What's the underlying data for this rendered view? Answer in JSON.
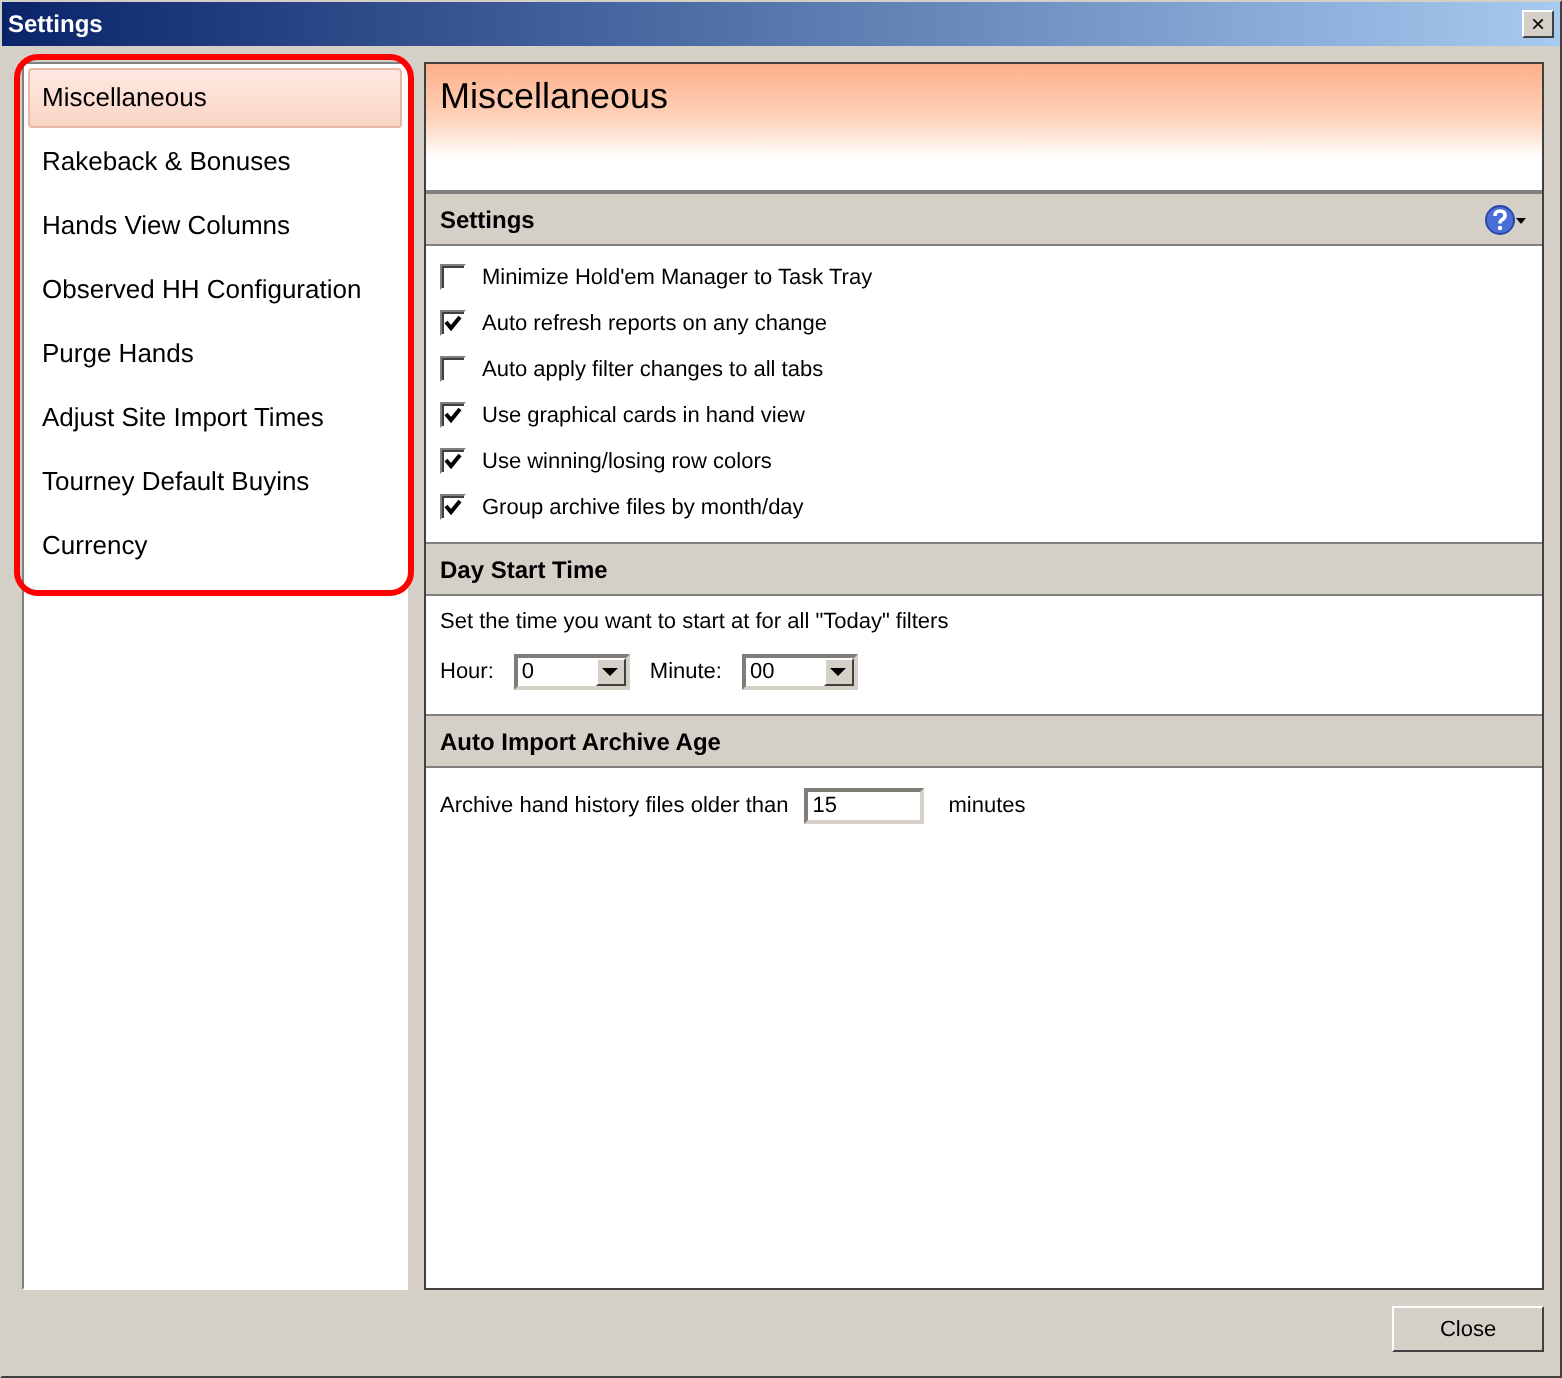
{
  "window": {
    "title": "Settings",
    "close": "×"
  },
  "sidebar": {
    "items": [
      {
        "label": "Miscellaneous",
        "selected": true
      },
      {
        "label": "Rakeback & Bonuses",
        "selected": false
      },
      {
        "label": "Hands View Columns",
        "selected": false
      },
      {
        "label": "Observed HH Configuration",
        "selected": false
      },
      {
        "label": "Purge Hands",
        "selected": false
      },
      {
        "label": "Adjust Site Import Times",
        "selected": false
      },
      {
        "label": "Tourney Default Buyins",
        "selected": false
      },
      {
        "label": "Currency",
        "selected": false
      }
    ]
  },
  "page_title": "Miscellaneous",
  "sections": [
    {
      "title": "Settings",
      "help": true,
      "kind": "checks",
      "options": [
        {
          "label": "Minimize Hold'em Manager to Task Tray",
          "checked": false
        },
        {
          "label": "Auto refresh reports on any change",
          "checked": true
        },
        {
          "label": "Auto apply filter changes to all tabs",
          "checked": false
        },
        {
          "label": "Use graphical cards in hand view",
          "checked": true
        },
        {
          "label": "Use winning/losing row colors",
          "checked": true
        },
        {
          "label": "Group archive files by month/day",
          "checked": true
        }
      ]
    },
    {
      "title": "Day Start Time",
      "kind": "time",
      "description": "Set the time you want to start at for all \"Today\" filters",
      "hour_label": "Hour:",
      "hour": "0",
      "minute_label": "Minute:",
      "minute": "00"
    },
    {
      "title": "Auto Import Archive Age",
      "kind": "age",
      "label": "Archive hand history files older than",
      "value": "15",
      "unit": "minutes"
    }
  ],
  "buttons": [
    "Close"
  ]
}
